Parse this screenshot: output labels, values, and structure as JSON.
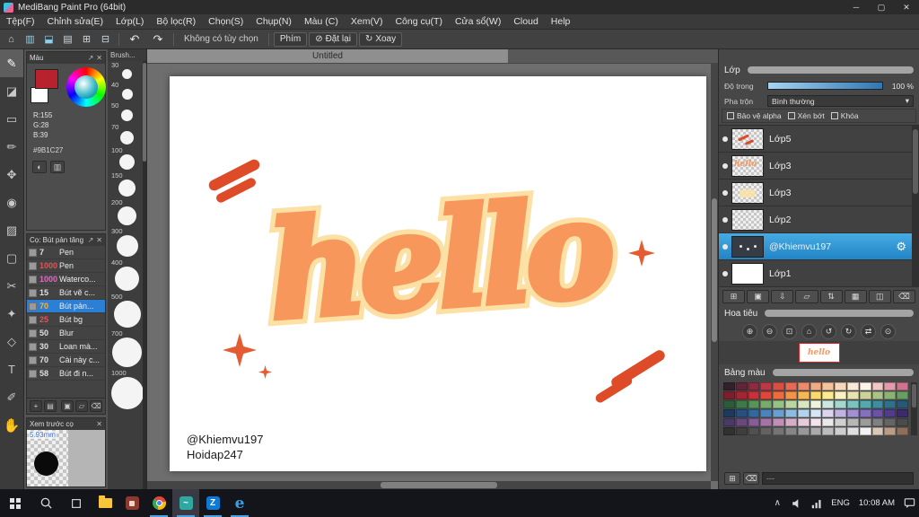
{
  "window": {
    "title": "MediBang Paint Pro (64bit)"
  },
  "menu": {
    "items": [
      "Tệp(F)",
      "Chỉnh sửa(E)",
      "Lớp(L)",
      "Bộ lọc(R)",
      "Chọn(S)",
      "Chụp(N)",
      "Màu (C)",
      "Xem(V)",
      "Công cụ(T)",
      "Cửa sổ(W)",
      "Cloud",
      "Help"
    ]
  },
  "toolbar": {
    "no_option": "Không có tùy chọn",
    "phim": "Phím",
    "dat_lai": "Đặt lại",
    "xoay": "Xoay"
  },
  "doc_tab": "Untitled",
  "color_panel": {
    "title": "Màu",
    "r": "R:155",
    "g": "G:28",
    "b": "B:39",
    "hex": "#9B1C27",
    "fg_color": "#b8222c"
  },
  "brushes": {
    "title": "Cọ: Bút pản tăng",
    "items": [
      {
        "size": "7",
        "name": "Pen",
        "color": "#e0e0e0"
      },
      {
        "size": "1000",
        "name": "Pen",
        "color": "#e05555"
      },
      {
        "size": "1000",
        "name": "Waterco...",
        "color": "#e06ac0"
      },
      {
        "size": "15",
        "name": "Bút vẽ c...",
        "color": "#e0e0e0"
      },
      {
        "size": "70",
        "name": "Bút pản...",
        "color": "#ffb040",
        "selected": true
      },
      {
        "size": "25",
        "name": "Bút bg",
        "color": "#e05555"
      },
      {
        "size": "50",
        "name": "Blur",
        "color": "#e0e0e0"
      },
      {
        "size": "30",
        "name": "Loan mà...",
        "color": "#e0e0e0"
      },
      {
        "size": "70",
        "name": "Cài này c...",
        "color": "#e0e0e0"
      },
      {
        "size": "58",
        "name": "Bút đi n...",
        "color": "#e0e0e0"
      }
    ]
  },
  "preview": {
    "title": "Xem trước cọ",
    "size_label": "5.93mm"
  },
  "brush_sizes": {
    "title": "Brush...",
    "sizes": [
      "30",
      "40",
      "50",
      "70",
      "100",
      "150",
      "200",
      "300",
      "400",
      "500",
      "700",
      "1000"
    ]
  },
  "canvas": {
    "word": "hello",
    "credit1": "@Khiemvu197",
    "credit2": "Hoidap247",
    "word_color": "#f8975c",
    "outline_color": "#fce0a4",
    "stroke_color": "#dd4b28"
  },
  "layers_panel": {
    "title": "Lớp",
    "opacity_label": "Độ trong",
    "opacity_value": "100 %",
    "blend_label": "Pha trộn",
    "blend_value": "Bình thường",
    "alpha_label": "Bảo vệ alpha",
    "clip_label": "Xén bớt",
    "lock_label": "Khóa",
    "layers": [
      {
        "name": "Lớp5"
      },
      {
        "name": "Lớp3"
      },
      {
        "name": "Lớp3"
      },
      {
        "name": "Lớp2"
      },
      {
        "name": "@Khiemvu197",
        "selected": true
      },
      {
        "name": "Lớp1"
      }
    ]
  },
  "navigator": {
    "title": "Hoa tiêu"
  },
  "palette": {
    "title": "Bảng màu",
    "field": "---",
    "colors": [
      "#33202d",
      "#5e2636",
      "#8c2c3e",
      "#bc3844",
      "#da4f44",
      "#e66a55",
      "#ec8a6b",
      "#f1a884",
      "#f5c29e",
      "#f8d8bc",
      "#fbe8d6",
      "#fdf3ea",
      "#f1c6c6",
      "#e39aab",
      "#cf7390",
      "#7c1f2c",
      "#a62433",
      "#ca2f3a",
      "#e2463a",
      "#ee6c3c",
      "#f49245",
      "#f8b851",
      "#fbd96c",
      "#fcea90",
      "#faf2c2",
      "#e7e2af",
      "#ccd29b",
      "#abc389",
      "#8ab374",
      "#679f62",
      "#2d5c3a",
      "#3e7a49",
      "#569559",
      "#75ac6c",
      "#97c285",
      "#bad7a2",
      "#d8e7c0",
      "#edf4da",
      "#cde7e0",
      "#a5d6d0",
      "#7cc2bf",
      "#56a8af",
      "#3e8da1",
      "#2e718e",
      "#275877",
      "#1e3a5a",
      "#27507c",
      "#33689e",
      "#4a84ba",
      "#67a0d0",
      "#8bbce0",
      "#b1d3ec",
      "#d5e7f5",
      "#dbd5ee",
      "#c0b3e0",
      "#a290d0",
      "#8570bd",
      "#6a52a6",
      "#513c8a",
      "#3c2a6c",
      "#483a64",
      "#68497e",
      "#885c94",
      "#a673a6",
      "#c08fb6",
      "#d6adc7",
      "#e8cbda",
      "#f4e3ec",
      "#e9e9e9",
      "#d0d0d0",
      "#b6b6b6",
      "#9b9b9b",
      "#808080",
      "#656565",
      "#4b4b4b",
      "#313131",
      "#3e3e3e",
      "#505050",
      "#626262",
      "#747474",
      "#868686",
      "#989898",
      "#aaaaaa",
      "#bcbcbc",
      "#cecece",
      "#e0e0e0",
      "#f2f2f2",
      "#dac8b9",
      "#ba9d86",
      "#906f58"
    ]
  },
  "taskbar": {
    "lang": "ENG",
    "time": "10:08 AM"
  },
  "icons": {
    "minimize": "─",
    "restore": "▢",
    "close": "✕",
    "tb_home": "⌂",
    "tb_panel": "▥",
    "tb_page": "⬓",
    "tb_grid": "▤",
    "tb_cells": "⊞",
    "tb_table": "⊟",
    "undo": "↶",
    "redo": "↷",
    "noentry": "⊘",
    "rotate": "↻",
    "popout": "↗",
    "close_small": "✕",
    "caret": "▾",
    "tool_brush": "✎",
    "tool_eraser": "◪",
    "tool_rect": "▭",
    "tool_pen": "✏",
    "tool_move": "✥",
    "tool_bucket": "◉",
    "tool_gradient": "▨",
    "tool_select": "▢",
    "tool_lasso": "✂",
    "tool_wand": "✦",
    "tool_shape": "◇",
    "tool_text": "T",
    "tool_dropper": "✐",
    "tool_hand": "✋",
    "cp_wheel": "◐",
    "cp_grid": "▥",
    "bf_add": "+",
    "bf_menu": "▤",
    "bf_page": "▣",
    "bf_folder": "▱",
    "bf_del": "⌫",
    "gear": "⚙",
    "lb_new": "⊞",
    "lb_dup": "▣",
    "lb_down": "⇩",
    "lb_folder": "▱",
    "lb_updown": "⇅",
    "lb_merge": "▦",
    "lb_flat": "◫",
    "lb_del": "⌫",
    "nv_in": "⊕",
    "nv_out": "⊖",
    "nv_fit": "⊡",
    "nv_orig": "⌂",
    "nv_rotl": "↺",
    "nv_rotr": "↻",
    "nv_flip": "⇄",
    "nv_reset": "⊙",
    "pal_new": "⊞",
    "pal_del": "⌫",
    "chevron_up": "∧",
    "app_medibang": "~",
    "app_zalo": "Z",
    "app_edge": "e"
  }
}
